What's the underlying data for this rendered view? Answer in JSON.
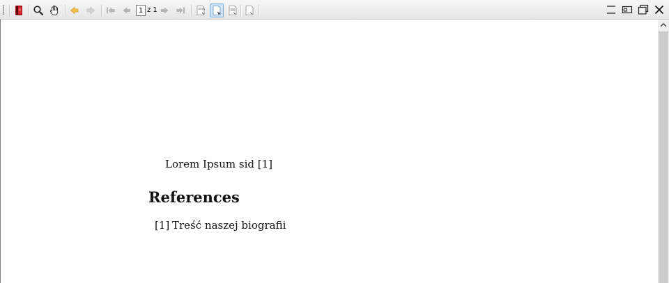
{
  "toolbar": {
    "page_number": "1",
    "page_of": "z 1",
    "buttons": [
      "open-book-icon",
      "zoom-icon",
      "hand-pan-icon",
      "back-icon",
      "forward-icon",
      "first-page-icon",
      "previous-page-icon",
      "next-page-icon",
      "last-page-icon",
      "actual-size-icon",
      "fit-page-icon",
      "fit-width-icon",
      "continuous-icon"
    ],
    "colors": {
      "accent": "#cfe3f8",
      "book": "#b0141a",
      "nav_arrow": "#f2c14b"
    }
  },
  "window_controls": [
    "minimize-icon",
    "restore-icon",
    "maximize-icon",
    "close-icon"
  ],
  "document": {
    "body_text": "Lorem Ipsum sid [1]",
    "references_heading": "References",
    "references": [
      {
        "num": "[1]",
        "text": "Treść naszej biografii"
      }
    ]
  }
}
